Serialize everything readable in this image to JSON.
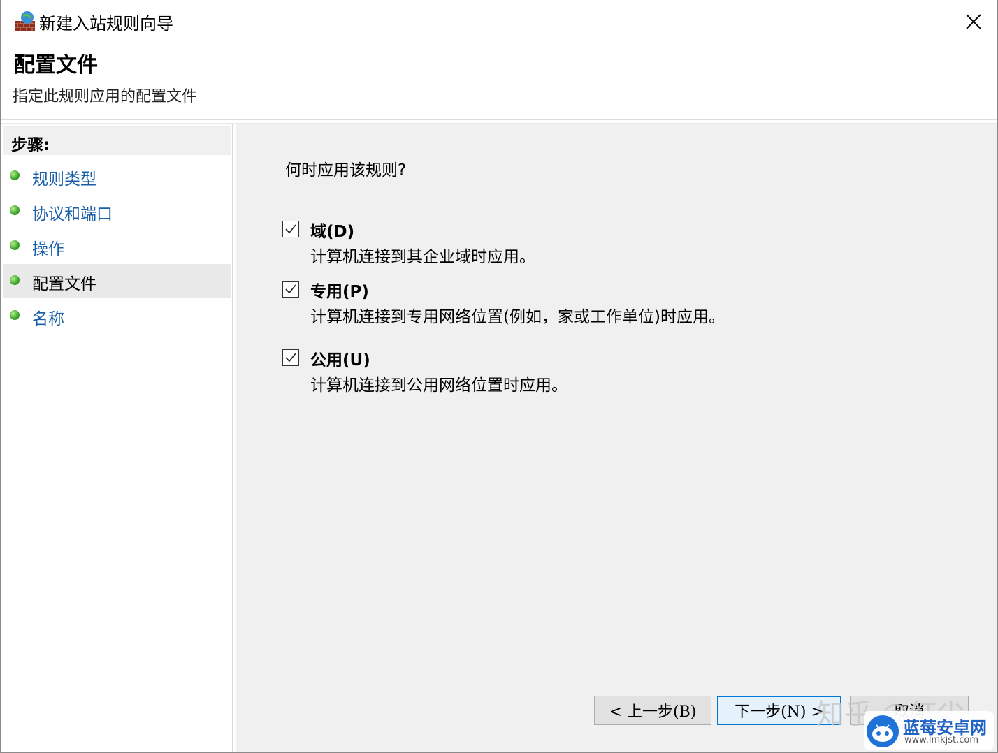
{
  "window": {
    "title": "新建入站规则向导"
  },
  "header": {
    "title": "配置文件",
    "subtitle": "指定此规则应用的配置文件"
  },
  "sidebar": {
    "heading": "步骤:",
    "items": [
      {
        "label": "规则类型",
        "active": false
      },
      {
        "label": "协议和端口",
        "active": false
      },
      {
        "label": "操作",
        "active": false
      },
      {
        "label": "配置文件",
        "active": true
      },
      {
        "label": "名称",
        "active": false
      }
    ]
  },
  "main": {
    "question": "何时应用该规则?",
    "options": [
      {
        "label": "域(D)",
        "checked": true,
        "description": "计算机连接到其企业域时应用。"
      },
      {
        "label": "专用(P)",
        "checked": true,
        "description": "计算机连接到专用网络位置(例如，家或工作单位)时应用。"
      },
      {
        "label": "公用(U)",
        "checked": true,
        "description": "计算机连接到公用网络位置时应用。"
      }
    ]
  },
  "buttons": {
    "back": "< 上一步(B)",
    "next": "下一步(N) >",
    "cancel": "取消"
  },
  "overlay": {
    "watermark": "知乎 @红尘",
    "logo_name": "蓝莓安卓网",
    "logo_url": "www.lmkjst.com"
  },
  "colors": {
    "link": "#1a5fa8",
    "accent": "#0078d7",
    "content_bg": "#f0f0f0"
  },
  "icons": {
    "app": "firewall-globe-icon",
    "close": "close-icon",
    "check": "checkmark-icon",
    "step": "green-dot-icon"
  }
}
